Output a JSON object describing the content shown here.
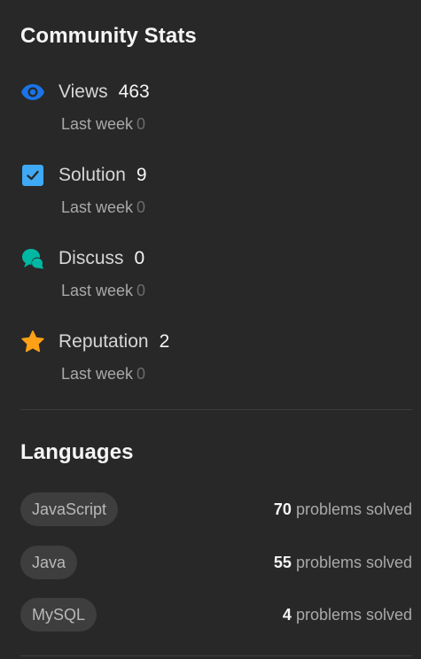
{
  "community": {
    "title": "Community Stats",
    "stats": [
      {
        "label": "Views",
        "value": "463",
        "sub_label": "Last week",
        "sub_value": "0",
        "icon": "eye-icon",
        "color": "#1a73e8"
      },
      {
        "label": "Solution",
        "value": "9",
        "sub_label": "Last week",
        "sub_value": "0",
        "icon": "check-square-icon",
        "color": "#3fa9f5"
      },
      {
        "label": "Discuss",
        "value": "0",
        "sub_label": "Last week",
        "sub_value": "0",
        "icon": "chat-bubbles-icon",
        "color": "#00b8a3"
      },
      {
        "label": "Reputation",
        "value": "2",
        "sub_label": "Last week",
        "sub_value": "0",
        "icon": "star-icon",
        "color": "#ffa116"
      }
    ]
  },
  "languages": {
    "title": "Languages",
    "suffix": "problems solved",
    "items": [
      {
        "name": "JavaScript",
        "count": "70"
      },
      {
        "name": "Java",
        "count": "55"
      },
      {
        "name": "MySQL",
        "count": "4"
      }
    ]
  }
}
